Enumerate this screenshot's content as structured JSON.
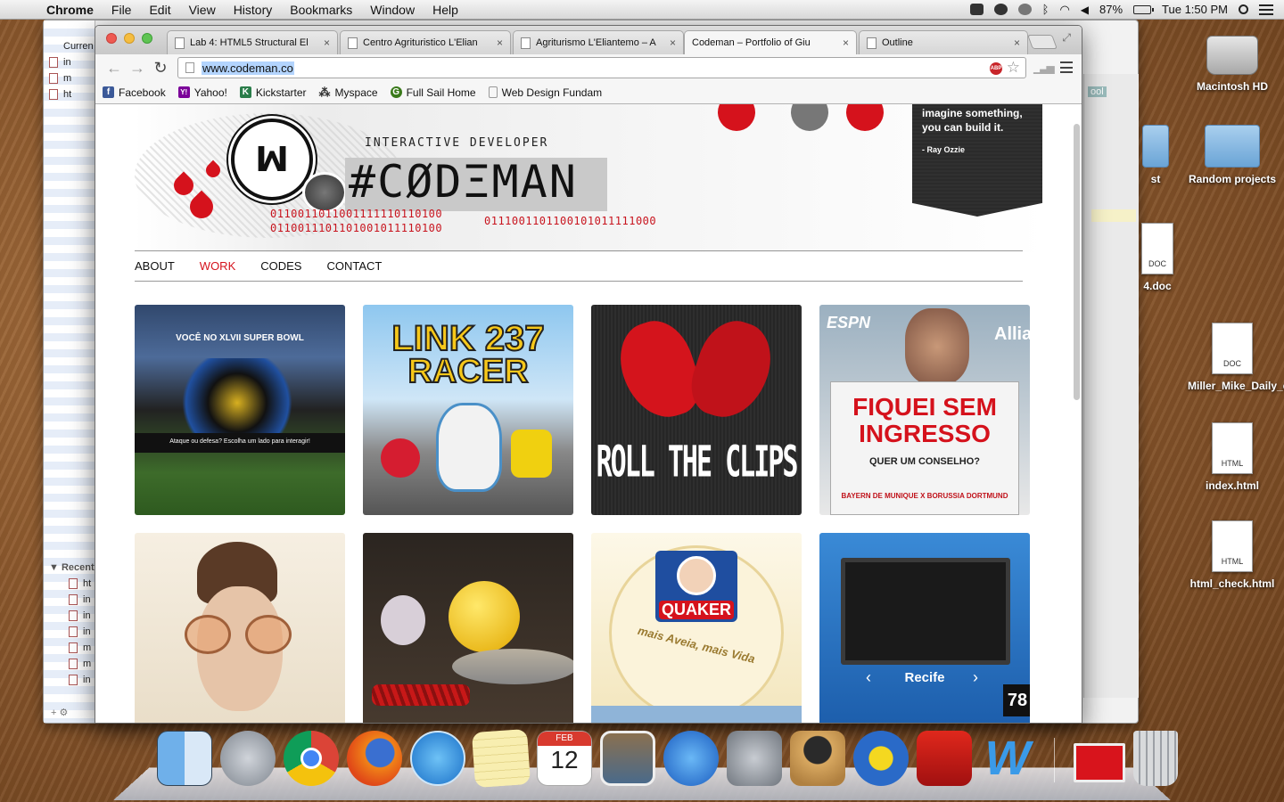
{
  "menubar": {
    "app_name": "Chrome",
    "items": [
      "File",
      "Edit",
      "View",
      "History",
      "Bookmarks",
      "Window",
      "Help"
    ],
    "battery": "87%",
    "clock": "Tue 1:50 PM"
  },
  "finder": {
    "sidebar_header": "Curren",
    "sidebar_items": [
      "in",
      "m",
      "ht"
    ],
    "recent_header": "Recent",
    "recent_items": [
      "ht",
      "in",
      "in",
      "in",
      "m",
      "m",
      "in"
    ]
  },
  "desktop": {
    "icons": [
      {
        "label": "Macintosh HD",
        "kind": "drive"
      },
      {
        "label": "Random projects",
        "kind": "folder"
      },
      {
        "label": "Miller_Mike_Daily_q...tions.",
        "kind": "doc",
        "badge": "DOC"
      },
      {
        "label": "index.html",
        "kind": "doc",
        "badge": "HTML"
      },
      {
        "label": "html_check.html",
        "kind": "doc",
        "badge": "HTML"
      }
    ],
    "partial_labels": [
      "ool",
      "st",
      "4.doc"
    ],
    "partial_badge": "DOC"
  },
  "browser": {
    "tabs": [
      {
        "title": "Lab 4: HTML5 Structural El",
        "active": false
      },
      {
        "title": "Centro Agrituristico L'Elian",
        "active": false
      },
      {
        "title": "Agriturismo L'Eliantemo – A",
        "active": false
      },
      {
        "title": "Codeman – Portfolio of Giu",
        "active": true
      },
      {
        "title": "Outline",
        "active": false
      }
    ],
    "tab_close_glyph": "×",
    "url": "www.codeman.co",
    "abp_label": "ABP",
    "bookmarks": [
      {
        "label": "Facebook",
        "icon": "facebook-icon",
        "color": "#3b5998",
        "glyph": "f"
      },
      {
        "label": "Yahoo!",
        "icon": "yahoo-icon",
        "color": "#7b0099",
        "glyph": "Y!"
      },
      {
        "label": "Kickstarter",
        "icon": "kickstarter-icon",
        "color": "#2a7d4a",
        "glyph": "K"
      },
      {
        "label": "Myspace",
        "icon": "myspace-icon",
        "color": "#333333",
        "glyph": "⁂"
      },
      {
        "label": "Full Sail Home",
        "icon": "fullsail-icon",
        "color": "#3a7a1a",
        "glyph": "G"
      },
      {
        "label": "Web Design Fundam",
        "icon": "page-icon",
        "color": "#ffffff",
        "glyph": ""
      }
    ]
  },
  "site": {
    "tagline": "INTERACTIVE DEVELOPER",
    "wordmark": "#CØDΞMAN",
    "logo_glyph": "ꟽ",
    "binary_1": "0110011011001111110110100",
    "binary_2": "0110011101101001011110100",
    "binary_3": "0111001101100101011111000",
    "quote": "imagine something, you can build it.",
    "quote_author": "- Ray Ozzie",
    "nav": [
      {
        "label": "ABOUT",
        "active": false
      },
      {
        "label": "WORK",
        "active": true
      },
      {
        "label": "CODES",
        "active": false
      },
      {
        "label": "CONTACT",
        "active": false
      }
    ],
    "tiles": [
      {
        "name": "superbowl-tile",
        "caption": "VOCÊ NO  XLVII  SUPER BOWL",
        "sub": "Ataque ou defesa? Escolha um lado para interagir!"
      },
      {
        "name": "link237-racer-tile",
        "caption": "LINK 237",
        "sub": "RACER"
      },
      {
        "name": "roll-the-clips-tile",
        "caption": "ROLL THE CLIPS",
        "sub": ""
      },
      {
        "name": "fiquei-sem-ingresso-tile",
        "caption": "FIQUEI SEM INGRESSO",
        "sub": "QUER UM CONSELHO?",
        "brand": "ESPN",
        "partner": "Allia",
        "match": "BAYERN DE MUNIQUE X BORUSSIA DORTMUND"
      },
      {
        "name": "fashion-portrait-tile",
        "caption": "",
        "sub": ""
      },
      {
        "name": "food-photo-tile",
        "caption": "",
        "sub": ""
      },
      {
        "name": "quaker-tile",
        "caption": "QUAKER",
        "sub": "mais Aveia, mais Vida"
      },
      {
        "name": "recife-tile",
        "caption": "Recife",
        "sub": "78"
      }
    ]
  },
  "dock": {
    "apps": [
      "finder-icon",
      "launchpad-icon",
      "chrome-icon",
      "firefox-icon",
      "itunes-icon",
      "notes-icon",
      "calendar-icon",
      "iphoto-icon",
      "app-store-icon",
      "system-preferences-icon",
      "github-icon",
      "coda-icon",
      "acrobat-icon",
      "word-icon"
    ],
    "calendar_month": "FEB",
    "calendar_day": "12"
  }
}
